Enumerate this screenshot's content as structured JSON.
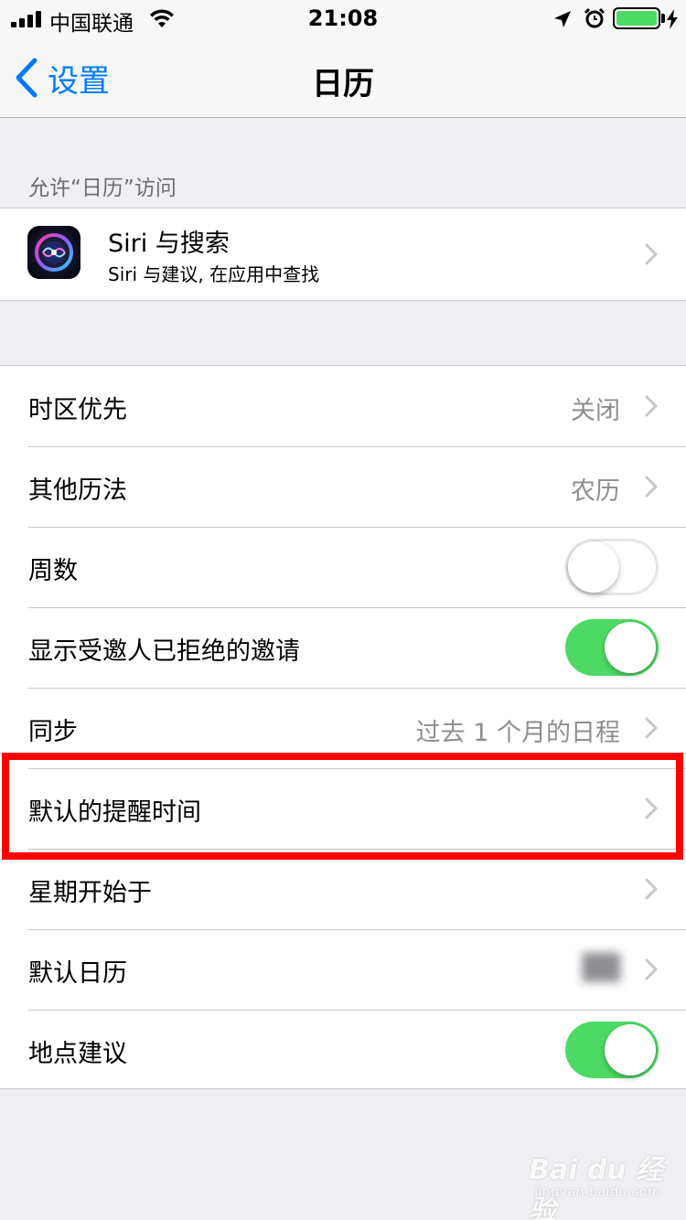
{
  "status_bar": {
    "carrier": "中国联通",
    "time": "21:08",
    "battery_level": 1.0,
    "battery_color": "#4cd964"
  },
  "nav": {
    "back_label": "设置",
    "title": "日历"
  },
  "siri_section": {
    "header": "允许“日历”访问",
    "title": "Siri 与搜索",
    "subtitle": "Siri 与建议, 在应用中查找"
  },
  "settings": [
    {
      "label": "时区优先",
      "value": "关闭",
      "control": "chevron"
    },
    {
      "label": "其他历法",
      "value": "农历",
      "control": "chevron"
    },
    {
      "label": "周数",
      "control": "toggle",
      "on": false
    },
    {
      "label": "显示受邀人已拒绝的邀请",
      "control": "toggle",
      "on": true
    },
    {
      "label": "同步",
      "value": "过去 1 个月的日程",
      "control": "chevron"
    },
    {
      "label": "默认的提醒时间",
      "value": "",
      "control": "chevron",
      "highlighted": true
    },
    {
      "label": "星期开始于",
      "value": "",
      "control": "chevron"
    },
    {
      "label": "默认日历",
      "value": "",
      "control": "chevron",
      "value_blurred": true
    },
    {
      "label": "地点建议",
      "control": "toggle",
      "on": true
    }
  ],
  "colors": {
    "accent": "#007aff",
    "toggle_on": "#4cd964",
    "highlight": "#ff0000",
    "background": "#efeff4"
  },
  "watermark": {
    "brand": "Bai du 经验",
    "sub": "jingyan.baidu.com"
  }
}
